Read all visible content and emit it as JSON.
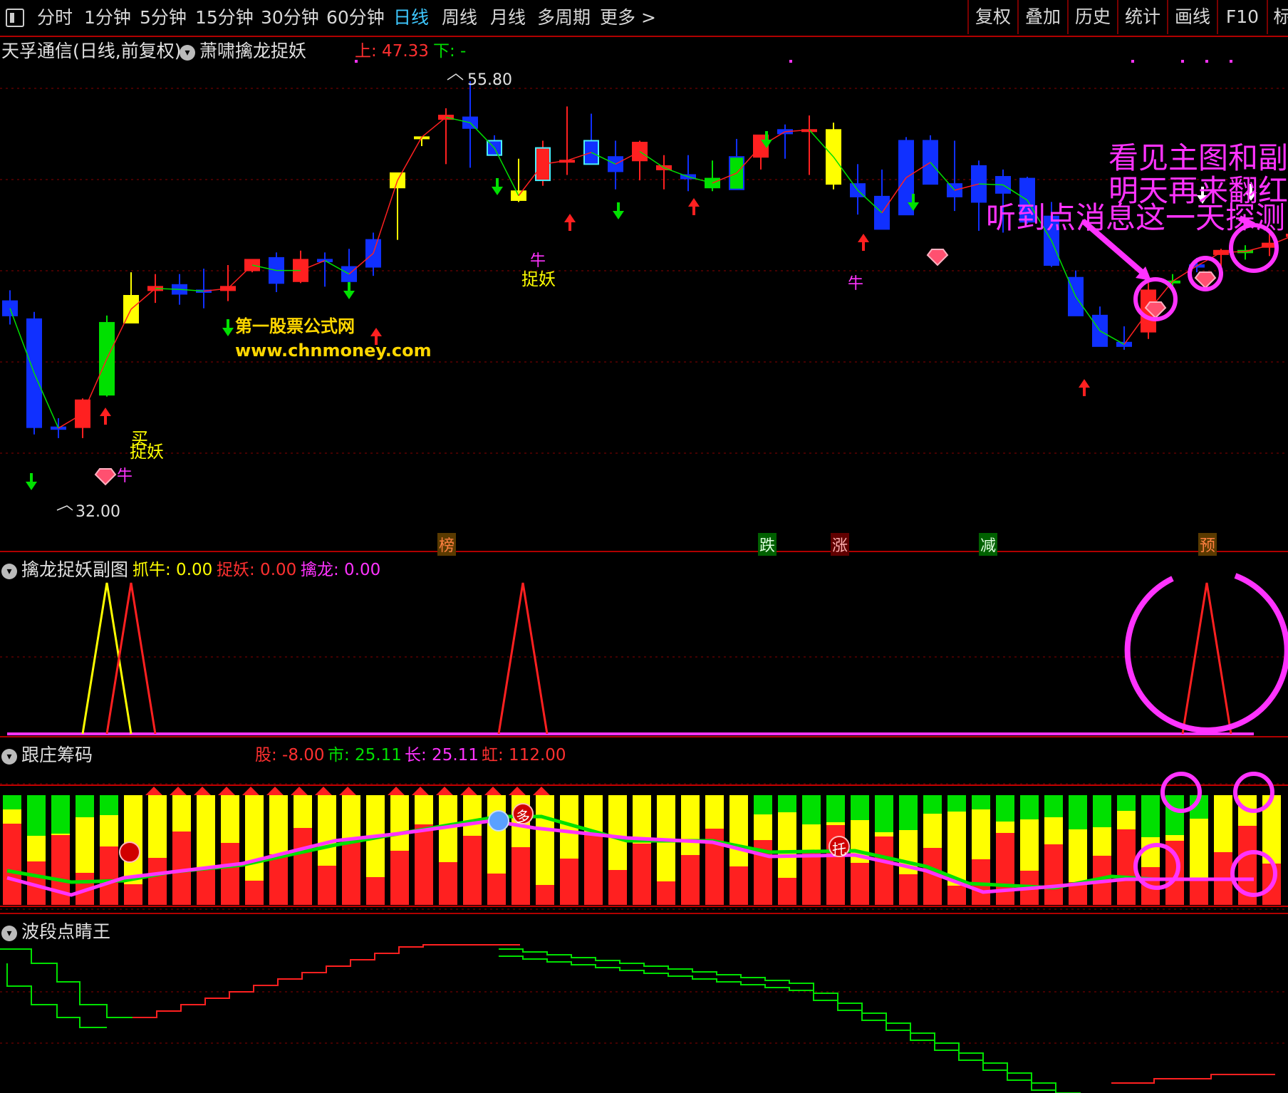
{
  "toolbar": {
    "periods": [
      "分时",
      "1分钟",
      "5分钟",
      "15分钟",
      "30分钟",
      "60分钟",
      "日线",
      "周线",
      "月线",
      "多周期",
      "更多 >"
    ],
    "active": "日线",
    "right": [
      "复权",
      "叠加",
      "历史",
      "统计",
      "画线",
      "F10",
      "标"
    ]
  },
  "main": {
    "title": "天孚通信(日线,前复权)",
    "indicator": "萧啸擒龙捉妖",
    "up_label": "上: 47.33",
    "down_label": "下: -",
    "high_label": "55.80",
    "low_label": "32.00",
    "watermark1": "第一股票公式网",
    "watermark2": "www.chnmoney.com",
    "buy_label": "买",
    "zhuoyao1": "捉妖",
    "zhuoyao2": "捉妖",
    "niu1": "牛",
    "niu2": "牛",
    "niu3": "牛",
    "bottom_tags": [
      "榜",
      "跌",
      "涨",
      "减",
      "预"
    ]
  },
  "annotations": {
    "line1": "看见主图和副",
    "line2": "明天再来翻红",
    "line3": "听到点消息这一天探测"
  },
  "sub1": {
    "title": "擒龙捉妖副图",
    "zhuaniu": "抓牛: 0.00",
    "zhuoyao": "捉妖: 0.00",
    "qinlong": "擒龙: 0.00"
  },
  "sub2": {
    "title": "跟庄筹码",
    "gu": "股: -8.00",
    "shi": "市: 25.11",
    "chang": "长: 25.11",
    "hong": "虹: 112.00",
    "duo": "多",
    "tuo": "托"
  },
  "sub3": {
    "title": "波段点睛王"
  },
  "colors": {
    "up": "#ff2020",
    "down_blue": "#1030ff",
    "yellow": "#ffff00",
    "green": "#00e000",
    "cyan": "#4af0ff",
    "magenta": "#ff33ff"
  },
  "chart_data": {
    "type": "candlestick",
    "ylim": [
      32.0,
      55.8
    ],
    "ohlc": [
      [
        43.6,
        44.2,
        42.3,
        42.8
      ],
      [
        42.6,
        43.0,
        36.2,
        36.6
      ],
      [
        36.6,
        37.1,
        36.0,
        36.5
      ],
      [
        36.6,
        38.2,
        36.0,
        38.1
      ],
      [
        38.4,
        42.8,
        38.3,
        42.4
      ],
      [
        42.4,
        45.2,
        42.4,
        43.9
      ],
      [
        44.2,
        45.1,
        43.5,
        44.4
      ],
      [
        44.5,
        45.1,
        43.4,
        44.0
      ],
      [
        44.2,
        45.4,
        43.2,
        44.1
      ],
      [
        44.2,
        45.6,
        43.6,
        44.4
      ],
      [
        45.3,
        45.9,
        45.2,
        45.9
      ],
      [
        46.0,
        46.3,
        44.1,
        44.6
      ],
      [
        44.7,
        46.4,
        44.6,
        45.9
      ],
      [
        45.9,
        46.3,
        44.4,
        45.8
      ],
      [
        45.5,
        46.5,
        44.6,
        44.7
      ],
      [
        47.0,
        47.4,
        45.0,
        45.5
      ],
      [
        49.9,
        50.0,
        47.0,
        50.7
      ],
      [
        52.7,
        52.7,
        52.2,
        52.7
      ],
      [
        53.7,
        54.3,
        51.2,
        53.9
      ],
      [
        53.8,
        55.8,
        51.0,
        53.2
      ],
      [
        52.5,
        52.8,
        51.7,
        51.7
      ],
      [
        49.2,
        51.5,
        49.1,
        49.7
      ],
      [
        50.3,
        52.5,
        50.0,
        52.1
      ],
      [
        51.4,
        54.4,
        50.6,
        51.4
      ],
      [
        52.5,
        54.0,
        51.3,
        51.2
      ],
      [
        51.6,
        52.5,
        49.8,
        50.8
      ],
      [
        51.4,
        52.5,
        50.3,
        52.4
      ],
      [
        50.9,
        51.7,
        49.8,
        51.1
      ],
      [
        50.6,
        51.7,
        49.7,
        50.4
      ],
      [
        49.9,
        51.4,
        49.7,
        50.4
      ],
      [
        51.6,
        52.6,
        49.9,
        49.8
      ],
      [
        51.6,
        52.6,
        50.9,
        52.8
      ],
      [
        53.1,
        53.4,
        51.5,
        52.9
      ],
      [
        53.1,
        53.9,
        50.6,
        53.1
      ],
      [
        53.1,
        53.5,
        49.8,
        50.1
      ],
      [
        50.1,
        51.2,
        48.4,
        49.4
      ],
      [
        49.4,
        50.9,
        47.8,
        47.6
      ],
      [
        52.5,
        52.7,
        48.7,
        48.4
      ],
      [
        52.5,
        52.8,
        50.1,
        50.1
      ],
      [
        50.1,
        52.5,
        48.6,
        49.4
      ],
      [
        51.1,
        51.4,
        47.5,
        49.1
      ],
      [
        50.5,
        50.9,
        47.4,
        49.6
      ],
      [
        50.4,
        50.5,
        47.9,
        48.0
      ],
      [
        48.3,
        49.1,
        45.5,
        45.6
      ],
      [
        44.9,
        45.3,
        43.1,
        42.8
      ],
      [
        42.8,
        43.3,
        41.2,
        41.1
      ],
      [
        41.3,
        42.2,
        40.9,
        41.1
      ],
      [
        41.9,
        44.6,
        41.5,
        44.2
      ],
      [
        44.7,
        45.1,
        44.4,
        44.7
      ],
      [
        45.6,
        46.0,
        45.2,
        45.5
      ],
      [
        46.2,
        46.5,
        45.5,
        46.4
      ],
      [
        46.3,
        46.7,
        45.9,
        46.4
      ],
      [
        46.6,
        47.6,
        46.1,
        46.8
      ],
      [
        47.2,
        47.9,
        46.8,
        47.3
      ],
      [
        47.9,
        48.5,
        47.4,
        47.8
      ]
    ]
  }
}
